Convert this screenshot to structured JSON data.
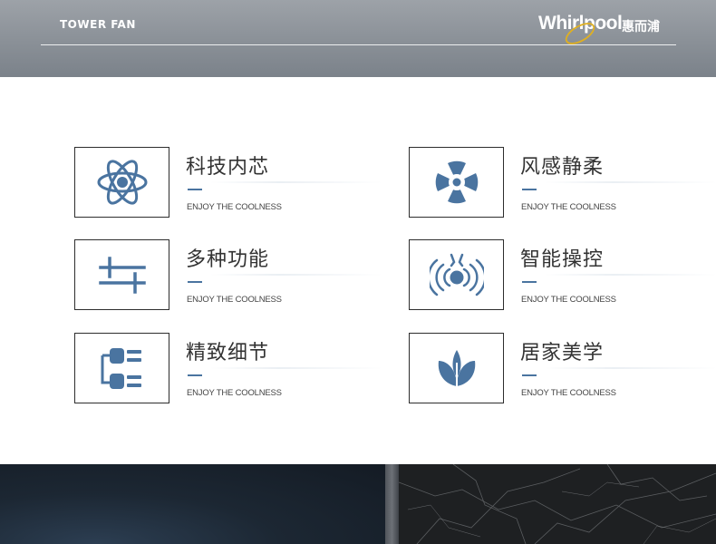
{
  "header": {
    "title": "TOWER FAN",
    "logo_text": "Whirlpool",
    "logo_cn": "惠而浦"
  },
  "features": [
    {
      "title": "科技内芯",
      "subtitle": "ENJOY THE COOLNESS",
      "icon": "atom-icon"
    },
    {
      "title": "风感静柔",
      "subtitle": "ENJOY THE COOLNESS",
      "icon": "fan-icon"
    },
    {
      "title": "多种功能",
      "subtitle": "ENJOY THE COOLNESS",
      "icon": "sliders-icon"
    },
    {
      "title": "智能操控",
      "subtitle": "ENJOY THE COOLNESS",
      "icon": "signal-icon"
    },
    {
      "title": "精致细节",
      "subtitle": "ENJOY THE COOLNESS",
      "icon": "tree-structure-icon"
    },
    {
      "title": "居家美学",
      "subtitle": "ENJOY THE COOLNESS",
      "icon": "leaf-icon"
    }
  ],
  "colors": {
    "icon_blue": "#4a74a0",
    "header_gray": "#8a9097",
    "box_border": "#2d2d2d",
    "swoosh_gold": "#e0b020"
  }
}
